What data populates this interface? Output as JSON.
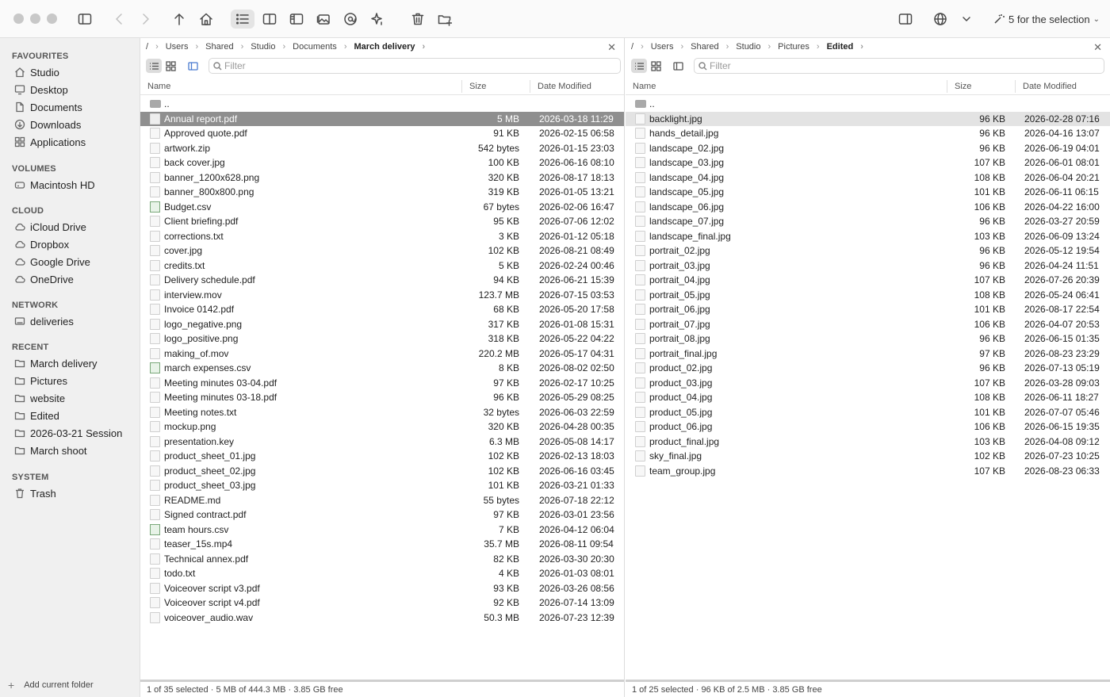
{
  "toolbar": {
    "selection_label": "5 for the selection"
  },
  "sidebar": {
    "sections": [
      {
        "title": "FAVOURITES",
        "items": [
          {
            "label": "Studio",
            "icon": "home-icon"
          },
          {
            "label": "Desktop",
            "icon": "desktop-icon"
          },
          {
            "label": "Documents",
            "icon": "document-icon"
          },
          {
            "label": "Downloads",
            "icon": "download-icon"
          },
          {
            "label": "Applications",
            "icon": "applications-icon"
          }
        ]
      },
      {
        "title": "VOLUMES",
        "items": [
          {
            "label": "Macintosh HD",
            "icon": "disk-icon"
          }
        ]
      },
      {
        "title": "CLOUD",
        "items": [
          {
            "label": "iCloud Drive",
            "icon": "cloud-icon"
          },
          {
            "label": "Dropbox",
            "icon": "cloud-icon"
          },
          {
            "label": "Google Drive",
            "icon": "cloud-icon"
          },
          {
            "label": "OneDrive",
            "icon": "cloud-icon"
          }
        ]
      },
      {
        "title": "NETWORK",
        "items": [
          {
            "label": "deliveries",
            "icon": "network-drive-icon"
          }
        ]
      },
      {
        "title": "RECENT",
        "items": [
          {
            "label": "March delivery",
            "icon": "folder-icon"
          },
          {
            "label": "Pictures",
            "icon": "folder-icon"
          },
          {
            "label": "website",
            "icon": "folder-icon"
          },
          {
            "label": "Edited",
            "icon": "folder-icon"
          },
          {
            "label": "2026-03-21 Session",
            "icon": "folder-icon"
          },
          {
            "label": "March shoot",
            "icon": "folder-icon"
          }
        ]
      },
      {
        "title": "SYSTEM",
        "items": [
          {
            "label": "Trash",
            "icon": "trash-icon"
          }
        ]
      }
    ],
    "footer_label": "Add current folder"
  },
  "left_pane": {
    "breadcrumb": [
      "/",
      "Users",
      "Shared",
      "Studio",
      "Documents",
      "March delivery"
    ],
    "filter_placeholder": "Filter",
    "columns": {
      "name": "Name",
      "size": "Size",
      "date": "Date Modified"
    },
    "parent": "..",
    "files": [
      {
        "name": "Annual report.pdf",
        "size": "5 MB",
        "date": "2026-03-18 11:29",
        "type": "file",
        "selected": true
      },
      {
        "name": "Approved quote.pdf",
        "size": "91 KB",
        "date": "2026-02-15 06:58",
        "type": "file"
      },
      {
        "name": "artwork.zip",
        "size": "542 bytes",
        "date": "2026-01-15 23:03",
        "type": "file"
      },
      {
        "name": "back cover.jpg",
        "size": "100 KB",
        "date": "2026-06-16 08:10",
        "type": "file"
      },
      {
        "name": "banner_1200x628.png",
        "size": "320 KB",
        "date": "2026-08-17 18:13",
        "type": "file"
      },
      {
        "name": "banner_800x800.png",
        "size": "319 KB",
        "date": "2026-01-05 13:21",
        "type": "file"
      },
      {
        "name": "Budget.csv",
        "size": "67 bytes",
        "date": "2026-02-06 16:47",
        "type": "csv"
      },
      {
        "name": "Client briefing.pdf",
        "size": "95 KB",
        "date": "2026-07-06 12:02",
        "type": "file"
      },
      {
        "name": "corrections.txt",
        "size": "3 KB",
        "date": "2026-01-12 05:18",
        "type": "file"
      },
      {
        "name": "cover.jpg",
        "size": "102 KB",
        "date": "2026-08-21 08:49",
        "type": "file"
      },
      {
        "name": "credits.txt",
        "size": "5 KB",
        "date": "2026-02-24 00:46",
        "type": "file"
      },
      {
        "name": "Delivery schedule.pdf",
        "size": "94 KB",
        "date": "2026-06-21 15:39",
        "type": "file"
      },
      {
        "name": "interview.mov",
        "size": "123.7 MB",
        "date": "2026-07-15 03:53",
        "type": "file"
      },
      {
        "name": "Invoice 0142.pdf",
        "size": "68 KB",
        "date": "2026-05-20 17:58",
        "type": "file"
      },
      {
        "name": "logo_negative.png",
        "size": "317 KB",
        "date": "2026-01-08 15:31",
        "type": "file"
      },
      {
        "name": "logo_positive.png",
        "size": "318 KB",
        "date": "2026-05-22 04:22",
        "type": "file"
      },
      {
        "name": "making_of.mov",
        "size": "220.2 MB",
        "date": "2026-05-17 04:31",
        "type": "file"
      },
      {
        "name": "march expenses.csv",
        "size": "8 KB",
        "date": "2026-08-02 02:50",
        "type": "csv"
      },
      {
        "name": "Meeting minutes 03-04.pdf",
        "size": "97 KB",
        "date": "2026-02-17 10:25",
        "type": "file"
      },
      {
        "name": "Meeting minutes 03-18.pdf",
        "size": "96 KB",
        "date": "2026-05-29 08:25",
        "type": "file"
      },
      {
        "name": "Meeting notes.txt",
        "size": "32 bytes",
        "date": "2026-06-03 22:59",
        "type": "file"
      },
      {
        "name": "mockup.png",
        "size": "320 KB",
        "date": "2026-04-28 00:35",
        "type": "file"
      },
      {
        "name": "presentation.key",
        "size": "6.3 MB",
        "date": "2026-05-08 14:17",
        "type": "file"
      },
      {
        "name": "product_sheet_01.jpg",
        "size": "102 KB",
        "date": "2026-02-13 18:03",
        "type": "file"
      },
      {
        "name": "product_sheet_02.jpg",
        "size": "102 KB",
        "date": "2026-06-16 03:45",
        "type": "file"
      },
      {
        "name": "product_sheet_03.jpg",
        "size": "101 KB",
        "date": "2026-03-21 01:33",
        "type": "file"
      },
      {
        "name": "README.md",
        "size": "55 bytes",
        "date": "2026-07-18 22:12",
        "type": "file"
      },
      {
        "name": "Signed contract.pdf",
        "size": "97 KB",
        "date": "2026-03-01 23:56",
        "type": "file"
      },
      {
        "name": "team hours.csv",
        "size": "7 KB",
        "date": "2026-04-12 06:04",
        "type": "csv"
      },
      {
        "name": "teaser_15s.mp4",
        "size": "35.7 MB",
        "date": "2026-08-11 09:54",
        "type": "file"
      },
      {
        "name": "Technical annex.pdf",
        "size": "82 KB",
        "date": "2026-03-30 20:30",
        "type": "file"
      },
      {
        "name": "todo.txt",
        "size": "4 KB",
        "date": "2026-01-03 08:01",
        "type": "file"
      },
      {
        "name": "Voiceover script v3.pdf",
        "size": "93 KB",
        "date": "2026-03-26 08:56",
        "type": "file"
      },
      {
        "name": "Voiceover script v4.pdf",
        "size": "92 KB",
        "date": "2026-07-14 13:09",
        "type": "file"
      },
      {
        "name": "voiceover_audio.wav",
        "size": "50.3 MB",
        "date": "2026-07-23 12:39",
        "type": "file"
      }
    ],
    "status": "1 of 35 selected · 5 MB of 444.3 MB · 3.85 GB free"
  },
  "right_pane": {
    "breadcrumb": [
      "/",
      "Users",
      "Shared",
      "Studio",
      "Pictures",
      "Edited"
    ],
    "filter_placeholder": "Filter",
    "columns": {
      "name": "Name",
      "size": "Size",
      "date": "Date Modified"
    },
    "parent": "..",
    "files": [
      {
        "name": "backlight.jpg",
        "size": "96 KB",
        "date": "2026-02-28 07:16",
        "type": "file",
        "selected": true
      },
      {
        "name": "hands_detail.jpg",
        "size": "96 KB",
        "date": "2026-04-16 13:07",
        "type": "file"
      },
      {
        "name": "landscape_02.jpg",
        "size": "96 KB",
        "date": "2026-06-19 04:01",
        "type": "file"
      },
      {
        "name": "landscape_03.jpg",
        "size": "107 KB",
        "date": "2026-06-01 08:01",
        "type": "file"
      },
      {
        "name": "landscape_04.jpg",
        "size": "108 KB",
        "date": "2026-06-04 20:21",
        "type": "file"
      },
      {
        "name": "landscape_05.jpg",
        "size": "101 KB",
        "date": "2026-06-11 06:15",
        "type": "file"
      },
      {
        "name": "landscape_06.jpg",
        "size": "106 KB",
        "date": "2026-04-22 16:00",
        "type": "file"
      },
      {
        "name": "landscape_07.jpg",
        "size": "96 KB",
        "date": "2026-03-27 20:59",
        "type": "file"
      },
      {
        "name": "landscape_final.jpg",
        "size": "103 KB",
        "date": "2026-06-09 13:24",
        "type": "file"
      },
      {
        "name": "portrait_02.jpg",
        "size": "96 KB",
        "date": "2026-05-12 19:54",
        "type": "file"
      },
      {
        "name": "portrait_03.jpg",
        "size": "96 KB",
        "date": "2026-04-24 11:51",
        "type": "file"
      },
      {
        "name": "portrait_04.jpg",
        "size": "107 KB",
        "date": "2026-07-26 20:39",
        "type": "file"
      },
      {
        "name": "portrait_05.jpg",
        "size": "108 KB",
        "date": "2026-05-24 06:41",
        "type": "file"
      },
      {
        "name": "portrait_06.jpg",
        "size": "101 KB",
        "date": "2026-08-17 22:54",
        "type": "file"
      },
      {
        "name": "portrait_07.jpg",
        "size": "106 KB",
        "date": "2026-04-07 20:53",
        "type": "file"
      },
      {
        "name": "portrait_08.jpg",
        "size": "96 KB",
        "date": "2026-06-15 01:35",
        "type": "file"
      },
      {
        "name": "portrait_final.jpg",
        "size": "97 KB",
        "date": "2026-08-23 23:29",
        "type": "file"
      },
      {
        "name": "product_02.jpg",
        "size": "96 KB",
        "date": "2026-07-13 05:19",
        "type": "file"
      },
      {
        "name": "product_03.jpg",
        "size": "107 KB",
        "date": "2026-03-28 09:03",
        "type": "file"
      },
      {
        "name": "product_04.jpg",
        "size": "108 KB",
        "date": "2026-06-11 18:27",
        "type": "file"
      },
      {
        "name": "product_05.jpg",
        "size": "101 KB",
        "date": "2026-07-07 05:46",
        "type": "file"
      },
      {
        "name": "product_06.jpg",
        "size": "106 KB",
        "date": "2026-06-15 19:35",
        "type": "file"
      },
      {
        "name": "product_final.jpg",
        "size": "103 KB",
        "date": "2026-04-08 09:12",
        "type": "file"
      },
      {
        "name": "sky_final.jpg",
        "size": "102 KB",
        "date": "2026-07-23 10:25",
        "type": "file"
      },
      {
        "name": "team_group.jpg",
        "size": "107 KB",
        "date": "2026-08-23 06:33",
        "type": "file"
      }
    ],
    "status": "1 of 25 selected · 96 KB of 2.5 MB · 3.85 GB free"
  }
}
